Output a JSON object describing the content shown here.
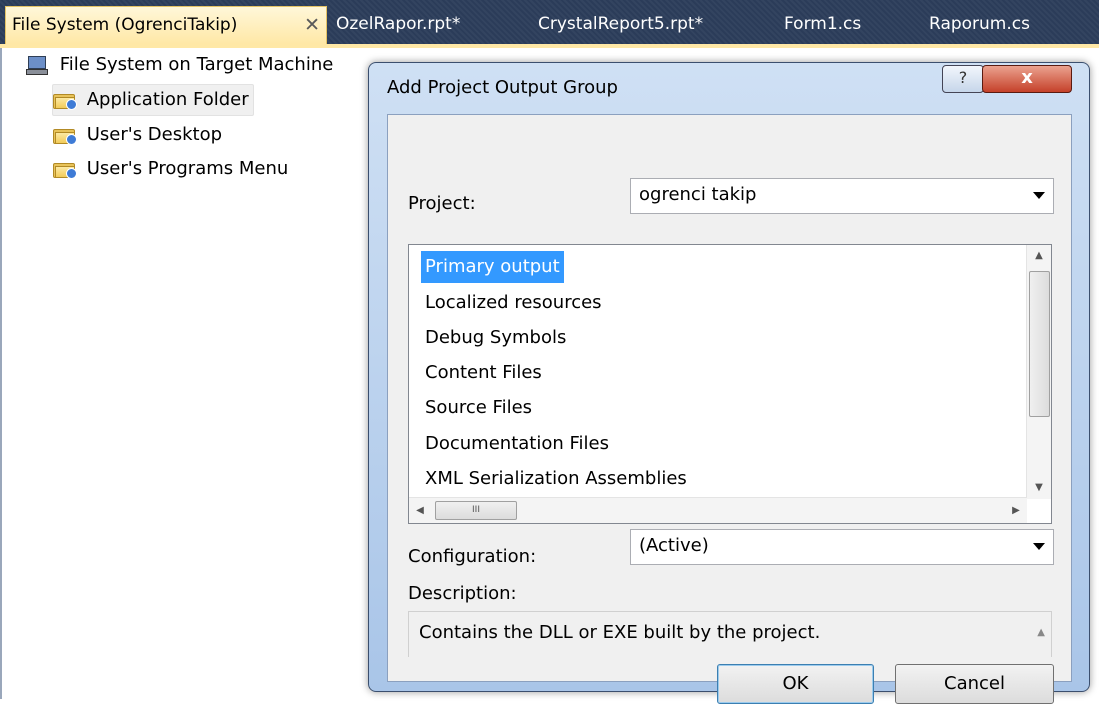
{
  "tabs": [
    {
      "label": "File System (OgrenciTakip)",
      "active": true,
      "close": "✕"
    },
    {
      "label": "OzelRapor.rpt*"
    },
    {
      "label": "CrystalReport5.rpt*"
    },
    {
      "label": "Form1.cs"
    },
    {
      "label": "Raporum.cs"
    }
  ],
  "tree": {
    "root": "File System on Target Machine",
    "items": [
      {
        "label": "Application Folder",
        "selected": true
      },
      {
        "label": "User's Desktop"
      },
      {
        "label": "User's Programs Menu"
      }
    ]
  },
  "dialog": {
    "title": "Add Project Output Group",
    "help": "?",
    "close": "x",
    "project_label": "Project:",
    "project_value": "ogrenci takip",
    "outputs": [
      "Primary output",
      "Localized resources",
      "Debug Symbols",
      "Content Files",
      "Source Files",
      "Documentation Files",
      "XML Serialization Assemblies"
    ],
    "selected_output": "Primary output",
    "hscroll_grip": "III",
    "configuration_label": "Configuration:",
    "configuration_value": "(Active)",
    "description_label": "Description:",
    "description_text": "Contains the DLL or EXE built by the project.",
    "ok": "OK",
    "cancel": "Cancel"
  },
  "colors": {
    "tab_bar": "#2b3c59",
    "active_tab": "#ffe8a6",
    "selection": "#3399ff",
    "close_button": "#c5412a"
  },
  "icons": [
    "computer-icon",
    "folder-icon",
    "help-icon",
    "close-icon",
    "chevron-down-icon"
  ]
}
